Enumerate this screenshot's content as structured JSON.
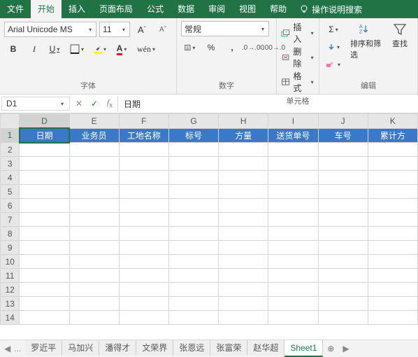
{
  "tabs": {
    "file": "文件",
    "home": "开始",
    "insert": "插入",
    "layout": "页面布局",
    "formulas": "公式",
    "data": "数据",
    "review": "审阅",
    "view": "视图",
    "help": "帮助",
    "search": "操作说明搜索"
  },
  "font": {
    "name": "Arial Unicode MS",
    "size": "11",
    "group_label": "字体",
    "bold": "B",
    "italic": "I",
    "underline": "U"
  },
  "number": {
    "format": "常规",
    "group_label": "数字",
    "percent": "%",
    "comma": ",",
    "inc": ".0",
    "dec": ".00"
  },
  "cells": {
    "group_label": "单元格",
    "insert": "插入",
    "delete": "删除",
    "format": "格式"
  },
  "editing": {
    "group_label": "编辑",
    "sigma": "Σ",
    "sort": "排序和筛选",
    "find": "查找"
  },
  "namebox": "D1",
  "formula_value": "日期",
  "columns": [
    "D",
    "E",
    "F",
    "G",
    "H",
    "I",
    "J",
    "K"
  ],
  "rows": [
    "1",
    "2",
    "3",
    "4",
    "5",
    "6",
    "7",
    "8",
    "9",
    "10",
    "11",
    "12",
    "13",
    "14"
  ],
  "header_cells": [
    "日期",
    "业务员",
    "工地名称",
    "标号",
    "方量",
    "送货单号",
    "车号",
    "累计方"
  ],
  "sheet_tabs": [
    "罗近平",
    "马加兴",
    "潘得才",
    "文荣界",
    "张恩远",
    "张富荣",
    "赵华超",
    "Sheet1"
  ],
  "ellipsis": "...",
  "plus": "+",
  "az": "A",
  "za": "Z",
  "arrow": "→"
}
